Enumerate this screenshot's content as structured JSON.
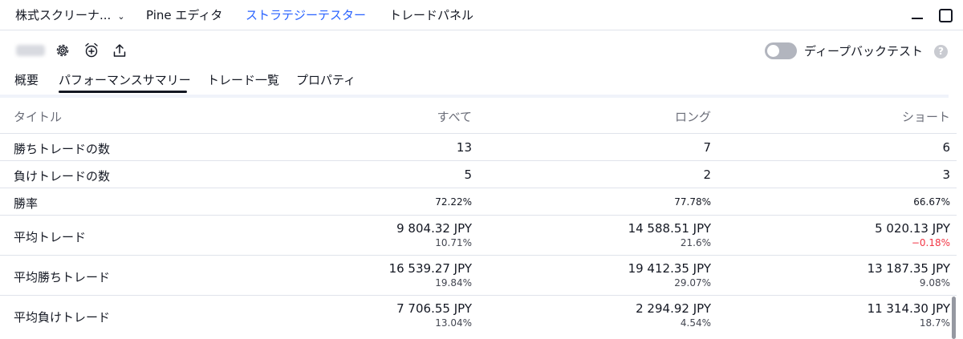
{
  "top_tabs": [
    {
      "label": "株式スクリーナ..."
    },
    {
      "label": "Pine エディタ"
    },
    {
      "label": "ストラテジーテスター"
    },
    {
      "label": "トレードパネル"
    }
  ],
  "toolbar": {
    "deep_backtest_label": "ディープバックテスト",
    "help_glyph": "?"
  },
  "sub_tabs": [
    {
      "label": "概要"
    },
    {
      "label": "パフォーマンスサマリー"
    },
    {
      "label": "トレード一覧"
    },
    {
      "label": "プロパティ"
    }
  ],
  "table": {
    "headers": {
      "title": "タイトル",
      "all": "すべて",
      "long": "ロング",
      "short": "ショート"
    },
    "rows": [
      {
        "title": "勝ちトレードの数",
        "all": "13",
        "long": "7",
        "short": "6"
      },
      {
        "title": "負けトレードの数",
        "all": "5",
        "long": "2",
        "short": "3"
      },
      {
        "title": "勝率",
        "all": "72.22%",
        "long": "77.78%",
        "short": "66.67%"
      },
      {
        "title": "平均トレード",
        "all": {
          "value": "9 804.32 JPY",
          "pct": "10.71%"
        },
        "long": {
          "value": "14 588.51 JPY",
          "pct": "21.6%"
        },
        "short": {
          "value": "5 020.13 JPY",
          "pct": "−0.18%"
        }
      },
      {
        "title": "平均勝ちトレード",
        "all": {
          "value": "16 539.27 JPY",
          "pct": "19.84%"
        },
        "long": {
          "value": "19 412.35 JPY",
          "pct": "29.07%"
        },
        "short": {
          "value": "13 187.35 JPY",
          "pct": "9.08%"
        }
      },
      {
        "title": "平均負けトレード",
        "all": {
          "value": "7 706.55 JPY",
          "pct": "13.04%"
        },
        "long": {
          "value": "2 294.92 JPY",
          "pct": "4.54%"
        },
        "short": {
          "value": "11 314.30 JPY",
          "pct": "18.7%"
        }
      }
    ]
  },
  "colors": {
    "accent": "#2962ff",
    "negative": "#f23645",
    "text": "#131722",
    "muted": "#6a6d78"
  }
}
